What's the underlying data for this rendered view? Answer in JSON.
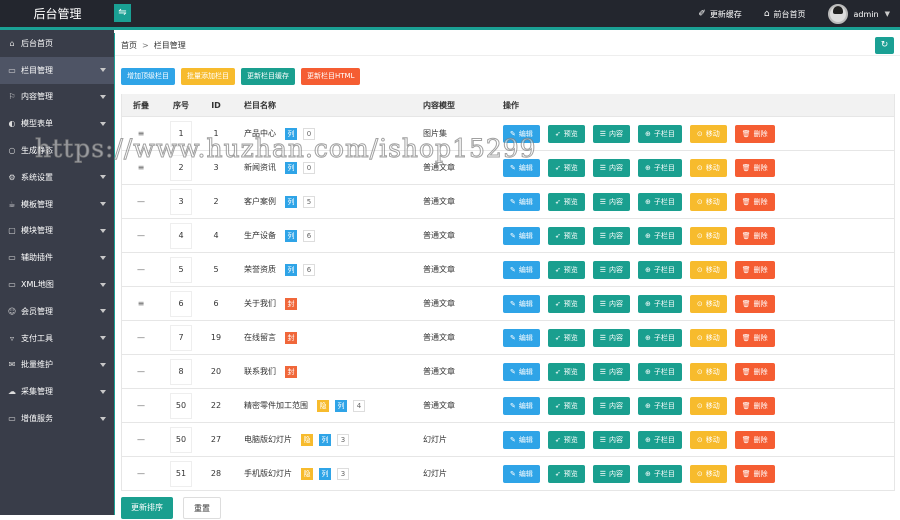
{
  "app": {
    "title": "后台管理",
    "toggle_icon": "menu-toggle-icon"
  },
  "topnav": {
    "items": [
      {
        "label": "更新缓存",
        "icon": "brush-icon"
      },
      {
        "label": "前台首页",
        "icon": "home-icon"
      }
    ],
    "user": "admin"
  },
  "sidebar": {
    "items": [
      {
        "label": "后台首页",
        "icon": "home-icon",
        "arrow": false,
        "active": false
      },
      {
        "label": "栏目管理",
        "icon": "monitor-icon",
        "arrow": true,
        "active": true
      },
      {
        "label": "内容管理",
        "icon": "flag-icon",
        "arrow": true,
        "active": false
      },
      {
        "label": "模型表单",
        "icon": "template-icon",
        "arrow": true,
        "active": false
      },
      {
        "label": "生成静态",
        "icon": "refresh-icon",
        "arrow": false,
        "active": false
      },
      {
        "label": "系统设置",
        "icon": "settings-icon",
        "arrow": true,
        "active": false
      },
      {
        "label": "模板管理",
        "icon": "cup-icon",
        "arrow": true,
        "active": false
      },
      {
        "label": "模块管理",
        "icon": "module-icon",
        "arrow": true,
        "active": false
      },
      {
        "label": "辅助插件",
        "icon": "plugin-icon",
        "arrow": true,
        "active": false
      },
      {
        "label": "XML地图",
        "icon": "map-icon",
        "arrow": true,
        "active": false
      },
      {
        "label": "会员管理",
        "icon": "user-icon",
        "arrow": true,
        "active": false
      },
      {
        "label": "支付工具",
        "icon": "pay-icon",
        "arrow": true,
        "active": false
      },
      {
        "label": "批量维护",
        "icon": "mail-icon",
        "arrow": true,
        "active": false
      },
      {
        "label": "采集管理",
        "icon": "cloud-icon",
        "arrow": true,
        "active": false
      },
      {
        "label": "增值服务",
        "icon": "service-icon",
        "arrow": true,
        "active": false
      }
    ]
  },
  "breadcrumb": {
    "home": "首页",
    "sep": ">",
    "current": "栏目管理"
  },
  "toolbar": {
    "buttons": [
      {
        "label": "增加顶级栏目",
        "color": "blue"
      },
      {
        "label": "批量添加栏目",
        "color": "yellow"
      },
      {
        "label": "更新栏目缓存",
        "color": "green"
      },
      {
        "label": "更新栏目HTML",
        "color": "red"
      }
    ]
  },
  "table": {
    "headers": {
      "fold": "折叠",
      "sort": "序号",
      "id": "ID",
      "name": "栏目名称",
      "model": "内容模型",
      "ops": "操作"
    },
    "ops": [
      {
        "label": "编辑",
        "icon": "✎",
        "color": "blue",
        "name": "edit"
      },
      {
        "label": "预览",
        "icon": "➶",
        "color": "green",
        "name": "preview"
      },
      {
        "label": "内容",
        "icon": "☰",
        "color": "green",
        "name": "content"
      },
      {
        "label": "子栏目",
        "icon": "⊕",
        "color": "green",
        "name": "subcategory"
      },
      {
        "label": "移动",
        "icon": "⊙",
        "color": "yellow",
        "name": "move"
      },
      {
        "label": "删除",
        "icon": "🗑",
        "color": "red",
        "name": "delete"
      }
    ],
    "rows": [
      {
        "fold": "≡",
        "sort": "1",
        "id": "1",
        "name": "产品中心",
        "badges": [
          {
            "t": "列",
            "c": "blue"
          }
        ],
        "count": "0",
        "model": "图片集"
      },
      {
        "fold": "≡",
        "sort": "2",
        "id": "3",
        "name": "新闻资讯",
        "badges": [
          {
            "t": "列",
            "c": "blue"
          }
        ],
        "count": "0",
        "model": "普通文章"
      },
      {
        "fold": "—",
        "sort": "3",
        "id": "2",
        "name": "客户案例",
        "badges": [
          {
            "t": "列",
            "c": "blue"
          }
        ],
        "count": "5",
        "model": "普通文章"
      },
      {
        "fold": "—",
        "sort": "4",
        "id": "4",
        "name": "生产设备",
        "badges": [
          {
            "t": "列",
            "c": "blue"
          }
        ],
        "count": "6",
        "model": "普通文章"
      },
      {
        "fold": "—",
        "sort": "5",
        "id": "5",
        "name": "荣誉资质",
        "badges": [
          {
            "t": "列",
            "c": "blue"
          }
        ],
        "count": "6",
        "model": "普通文章"
      },
      {
        "fold": "≡",
        "sort": "6",
        "id": "6",
        "name": "关于我们",
        "badges": [
          {
            "t": "封",
            "c": "red"
          }
        ],
        "count": null,
        "model": "普通文章"
      },
      {
        "fold": "—",
        "sort": "7",
        "id": "19",
        "name": "在线留言",
        "badges": [
          {
            "t": "封",
            "c": "red"
          }
        ],
        "count": null,
        "model": "普通文章"
      },
      {
        "fold": "—",
        "sort": "8",
        "id": "20",
        "name": "联系我们",
        "badges": [
          {
            "t": "封",
            "c": "red"
          }
        ],
        "count": null,
        "model": "普通文章"
      },
      {
        "fold": "—",
        "sort": "50",
        "id": "22",
        "name": "精密零件加工范围",
        "badges": [
          {
            "t": "隐",
            "c": "yellow"
          },
          {
            "t": "列",
            "c": "blue"
          }
        ],
        "count": "4",
        "model": "普通文章"
      },
      {
        "fold": "—",
        "sort": "50",
        "id": "27",
        "name": "电脑版幻灯片",
        "badges": [
          {
            "t": "隐",
            "c": "yellow"
          },
          {
            "t": "列",
            "c": "blue"
          }
        ],
        "count": "3",
        "model": "幻灯片"
      },
      {
        "fold": "—",
        "sort": "51",
        "id": "28",
        "name": "手机版幻灯片",
        "badges": [
          {
            "t": "隐",
            "c": "yellow"
          },
          {
            "t": "列",
            "c": "blue"
          }
        ],
        "count": "3",
        "model": "幻灯片"
      }
    ]
  },
  "footer": {
    "update_sort": "更新排序",
    "reset": "重置"
  },
  "watermark": "https://www.huzhan.com/ishop15299",
  "colors": {
    "accent": "#1aa094",
    "blue": "#2fa4e7",
    "yellow": "#f7bb2d",
    "red": "#f55d32",
    "topbar": "#23262e",
    "sidebar": "#393d49"
  }
}
